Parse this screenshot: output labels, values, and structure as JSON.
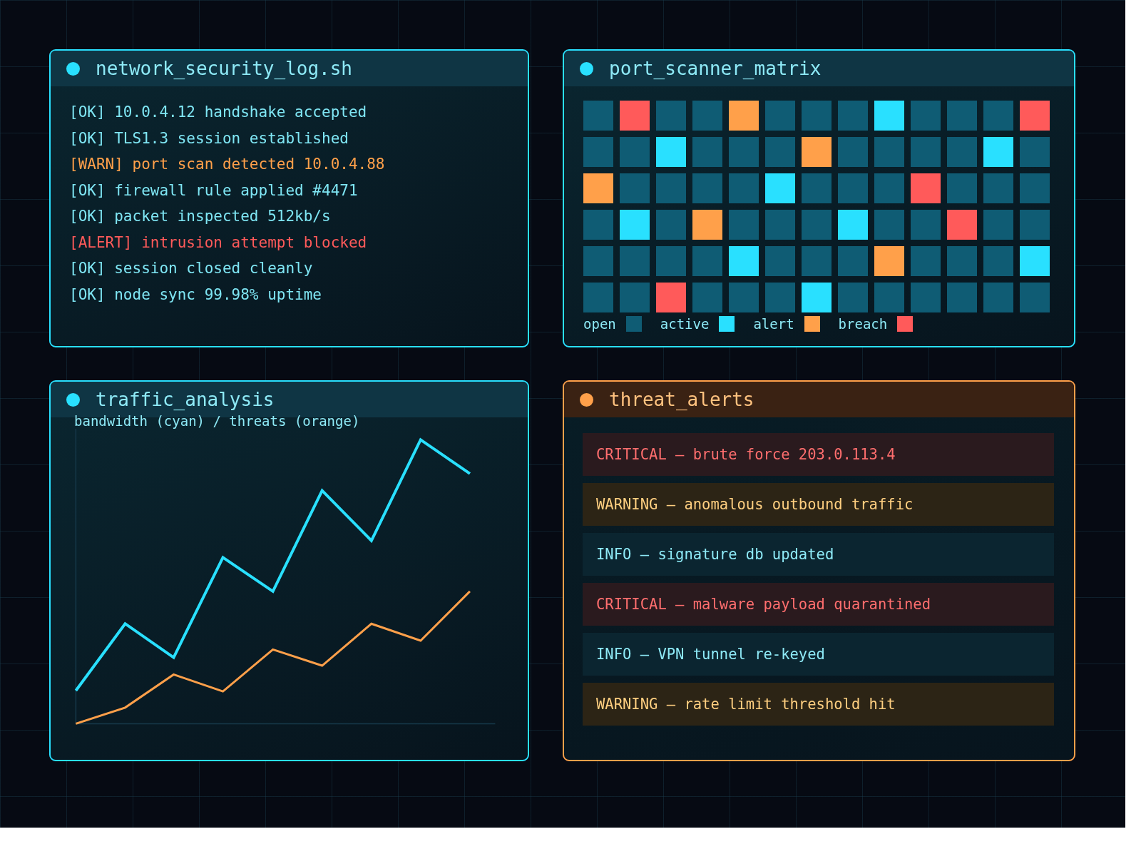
{
  "panels": [
    {
      "kind": "log",
      "title": "network_security_log.sh",
      "color": "#29e0ff",
      "lines": [
        {
          "kind": "ok",
          "tag": "[OK]",
          "text": "10.0.4.12 handshake accepted"
        },
        {
          "kind": "ok",
          "tag": "[OK]",
          "text": "TLS1.3 session established"
        },
        {
          "kind": "warn",
          "tag": "[WARN]",
          "text": "port scan detected 10.0.4.88"
        },
        {
          "kind": "ok",
          "tag": "[OK]",
          "text": "firewall rule applied #4471"
        },
        {
          "kind": "ok",
          "tag": "[OK]",
          "text": "packet inspected 512kb/s"
        },
        {
          "kind": "alert",
          "tag": "[ALERT]",
          "text": "intrusion attempt blocked"
        },
        {
          "kind": "ok",
          "tag": "[OK]",
          "text": "session closed cleanly"
        },
        {
          "kind": "ok",
          "tag": "[OK]",
          "text": "node sync 99.98% uptime"
        }
      ]
    },
    {
      "kind": "matrix",
      "title": "port_scanner_matrix",
      "color": "#29e0ff",
      "rows": [
        [
          {
            "kind": "open"
          },
          {
            "kind": "breach"
          },
          {
            "kind": "open"
          },
          {
            "kind": "open"
          },
          {
            "kind": "alert"
          },
          {
            "kind": "open"
          },
          {
            "kind": "open"
          },
          {
            "kind": "open"
          },
          {
            "kind": "active"
          },
          {
            "kind": "open"
          },
          {
            "kind": "open"
          },
          {
            "kind": "open"
          },
          {
            "kind": "breach"
          }
        ],
        [
          {
            "kind": "open"
          },
          {
            "kind": "open"
          },
          {
            "kind": "active"
          },
          {
            "kind": "open"
          },
          {
            "kind": "open"
          },
          {
            "kind": "open"
          },
          {
            "kind": "alert"
          },
          {
            "kind": "open"
          },
          {
            "kind": "open"
          },
          {
            "kind": "open"
          },
          {
            "kind": "open"
          },
          {
            "kind": "active"
          },
          {
            "kind": "open"
          }
        ],
        [
          {
            "kind": "alert"
          },
          {
            "kind": "open"
          },
          {
            "kind": "open"
          },
          {
            "kind": "open"
          },
          {
            "kind": "open"
          },
          {
            "kind": "active"
          },
          {
            "kind": "open"
          },
          {
            "kind": "open"
          },
          {
            "kind": "open"
          },
          {
            "kind": "breach"
          },
          {
            "kind": "open"
          },
          {
            "kind": "open"
          },
          {
            "kind": "open"
          }
        ],
        [
          {
            "kind": "open"
          },
          {
            "kind": "active"
          },
          {
            "kind": "open"
          },
          {
            "kind": "alert"
          },
          {
            "kind": "open"
          },
          {
            "kind": "open"
          },
          {
            "kind": "open"
          },
          {
            "kind": "active"
          },
          {
            "kind": "open"
          },
          {
            "kind": "open"
          },
          {
            "kind": "breach"
          },
          {
            "kind": "open"
          },
          {
            "kind": "open"
          }
        ],
        [
          {
            "kind": "open"
          },
          {
            "kind": "open"
          },
          {
            "kind": "open"
          },
          {
            "kind": "open"
          },
          {
            "kind": "active"
          },
          {
            "kind": "open"
          },
          {
            "kind": "open"
          },
          {
            "kind": "open"
          },
          {
            "kind": "alert"
          },
          {
            "kind": "open"
          },
          {
            "kind": "open"
          },
          {
            "kind": "open"
          },
          {
            "kind": "active"
          }
        ],
        [
          {
            "kind": "open"
          },
          {
            "kind": "open"
          },
          {
            "kind": "breach"
          },
          {
            "kind": "open"
          },
          {
            "kind": "open"
          },
          {
            "kind": "open"
          },
          {
            "kind": "active"
          },
          {
            "kind": "open"
          },
          {
            "kind": "open"
          },
          {
            "kind": "open"
          },
          {
            "kind": "open"
          },
          {
            "kind": "open"
          },
          {
            "kind": "open"
          }
        ]
      ],
      "legend": [
        {
          "label": "open",
          "color": "#0f5c74"
        },
        {
          "label": "active",
          "color": "#29e0ff"
        },
        {
          "label": "alert",
          "color": "#ffa04a"
        },
        {
          "label": "breach",
          "color": "#ff5a5a"
        }
      ]
    },
    {
      "kind": "chart",
      "title": "traffic_analysis",
      "color": "#29e0ff",
      "caption": "bandwidth (cyan) / threats (orange)"
    },
    {
      "kind": "alerts",
      "title": "threat_alerts",
      "color": "#ffa04a",
      "alerts": [
        {
          "kind": "critical",
          "text": "CRITICAL — brute force 203.0.113.4"
        },
        {
          "kind": "warning",
          "text": "WARNING — anomalous outbound traffic"
        },
        {
          "kind": "info",
          "text": "INFO — signature db updated"
        },
        {
          "kind": "critical",
          "text": "CRITICAL — malware payload quarantined"
        },
        {
          "kind": "info",
          "text": "INFO — VPN tunnel re-keyed"
        },
        {
          "kind": "warning",
          "text": "WARNING — rate limit threshold hit"
        }
      ]
    }
  ]
}
